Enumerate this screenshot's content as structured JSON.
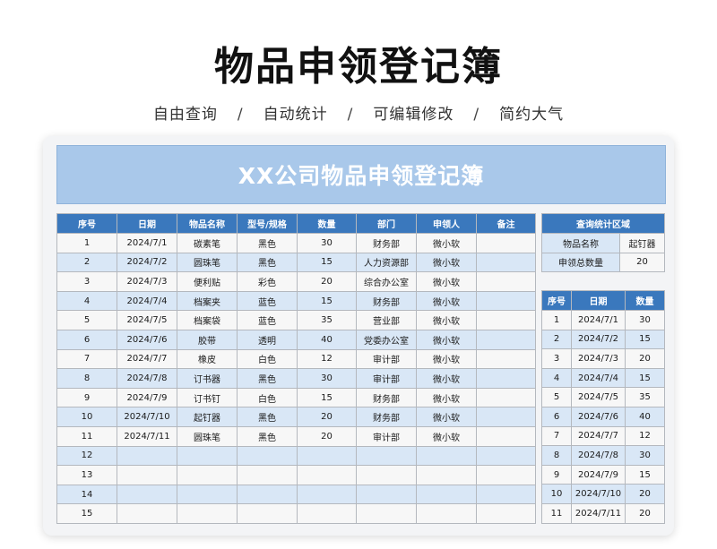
{
  "page": {
    "title": "物品申领登记簿",
    "subtitle_items": [
      "自由查询",
      "自动统计",
      "可编辑修改",
      "简约大气"
    ],
    "subtitle_separator": "/"
  },
  "banner": {
    "title": "XX公司物品申领登记簿"
  },
  "main_table": {
    "headers": [
      "序号",
      "日期",
      "物品名称",
      "型号/规格",
      "数量",
      "部门",
      "申领人",
      "备注"
    ],
    "rows": [
      [
        "1",
        "2024/7/1",
        "碳素笔",
        "黑色",
        "30",
        "财务部",
        "微小软",
        ""
      ],
      [
        "2",
        "2024/7/2",
        "圆珠笔",
        "黑色",
        "15",
        "人力资源部",
        "微小软",
        ""
      ],
      [
        "3",
        "2024/7/3",
        "便利贴",
        "彩色",
        "20",
        "综合办公室",
        "微小软",
        ""
      ],
      [
        "4",
        "2024/7/4",
        "档案夹",
        "蓝色",
        "15",
        "财务部",
        "微小软",
        ""
      ],
      [
        "5",
        "2024/7/5",
        "档案袋",
        "蓝色",
        "35",
        "营业部",
        "微小软",
        ""
      ],
      [
        "6",
        "2024/7/6",
        "胶带",
        "透明",
        "40",
        "党委办公室",
        "微小软",
        ""
      ],
      [
        "7",
        "2024/7/7",
        "橡皮",
        "白色",
        "12",
        "审计部",
        "微小软",
        ""
      ],
      [
        "8",
        "2024/7/8",
        "订书器",
        "黑色",
        "30",
        "审计部",
        "微小软",
        ""
      ],
      [
        "9",
        "2024/7/9",
        "订书钉",
        "白色",
        "15",
        "财务部",
        "微小软",
        ""
      ],
      [
        "10",
        "2024/7/10",
        "起钉器",
        "黑色",
        "20",
        "财务部",
        "微小软",
        ""
      ],
      [
        "11",
        "2024/7/11",
        "圆珠笔",
        "黑色",
        "20",
        "审计部",
        "微小软",
        ""
      ],
      [
        "12",
        "",
        "",
        "",
        "",
        "",
        "",
        ""
      ],
      [
        "13",
        "",
        "",
        "",
        "",
        "",
        "",
        ""
      ],
      [
        "14",
        "",
        "",
        "",
        "",
        "",
        "",
        ""
      ],
      [
        "15",
        "",
        "",
        "",
        "",
        "",
        "",
        ""
      ]
    ]
  },
  "query": {
    "title": "查询统计区域",
    "item_label": "物品名称",
    "item_value": "起钉器",
    "total_label": "申领总数量",
    "total_value": "20"
  },
  "side_table": {
    "headers": [
      "序号",
      "日期",
      "数量"
    ],
    "rows": [
      [
        "1",
        "2024/7/1",
        "30"
      ],
      [
        "2",
        "2024/7/2",
        "15"
      ],
      [
        "3",
        "2024/7/3",
        "20"
      ],
      [
        "4",
        "2024/7/4",
        "15"
      ],
      [
        "5",
        "2024/7/5",
        "35"
      ],
      [
        "6",
        "2024/7/6",
        "40"
      ],
      [
        "7",
        "2024/7/7",
        "12"
      ],
      [
        "8",
        "2024/7/8",
        "30"
      ],
      [
        "9",
        "2024/7/9",
        "15"
      ],
      [
        "10",
        "2024/7/10",
        "20"
      ],
      [
        "11",
        "2024/7/11",
        "20"
      ]
    ]
  },
  "colors": {
    "header_blue": "#3a78bd",
    "banner_blue": "#a9c8ea",
    "row_stripe": "#d9e7f6"
  }
}
